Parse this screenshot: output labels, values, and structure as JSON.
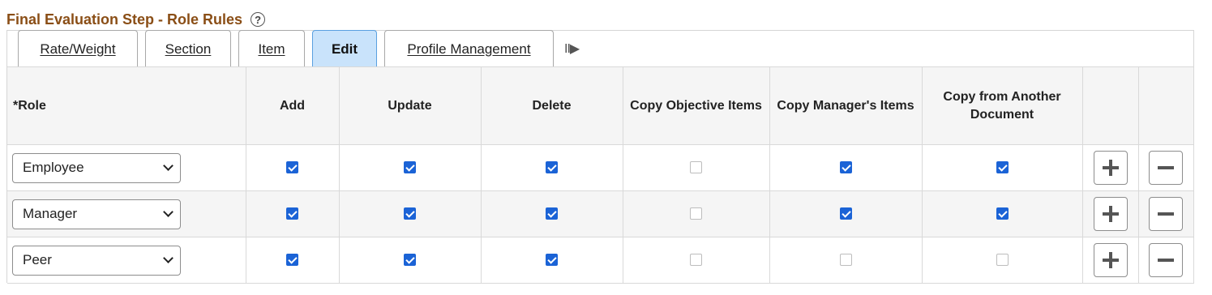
{
  "header": {
    "title": "Final Evaluation Step - Role Rules",
    "help_icon": "question-circle-icon"
  },
  "tabs": [
    {
      "label": "Rate/Weight",
      "active": false
    },
    {
      "label": "Section",
      "active": false
    },
    {
      "label": "Item",
      "active": false
    },
    {
      "label": "Edit",
      "active": true
    },
    {
      "label": "Profile Management",
      "active": false
    }
  ],
  "tabs_more": {
    "label": "II▶",
    "icon": "show-all-columns-icon"
  },
  "table": {
    "columns": [
      "*Role",
      "Add",
      "Update",
      "Delete",
      "Copy Objective Items",
      "Copy Manager's Items",
      "Copy from Another Document",
      "",
      ""
    ],
    "rows": [
      {
        "role": "Employee",
        "add": true,
        "update": true,
        "delete": true,
        "copy_objective": false,
        "copy_manager": true,
        "copy_another": true
      },
      {
        "role": "Manager",
        "add": true,
        "update": true,
        "delete": true,
        "copy_objective": false,
        "copy_manager": true,
        "copy_another": true
      },
      {
        "role": "Peer",
        "add": true,
        "update": true,
        "delete": true,
        "copy_objective": false,
        "copy_manager": false,
        "copy_another": false
      }
    ]
  },
  "colors": {
    "title": "#8a4e16",
    "active_tab": "#c9e3fb",
    "checkbox_checked": "#1b63d6"
  }
}
